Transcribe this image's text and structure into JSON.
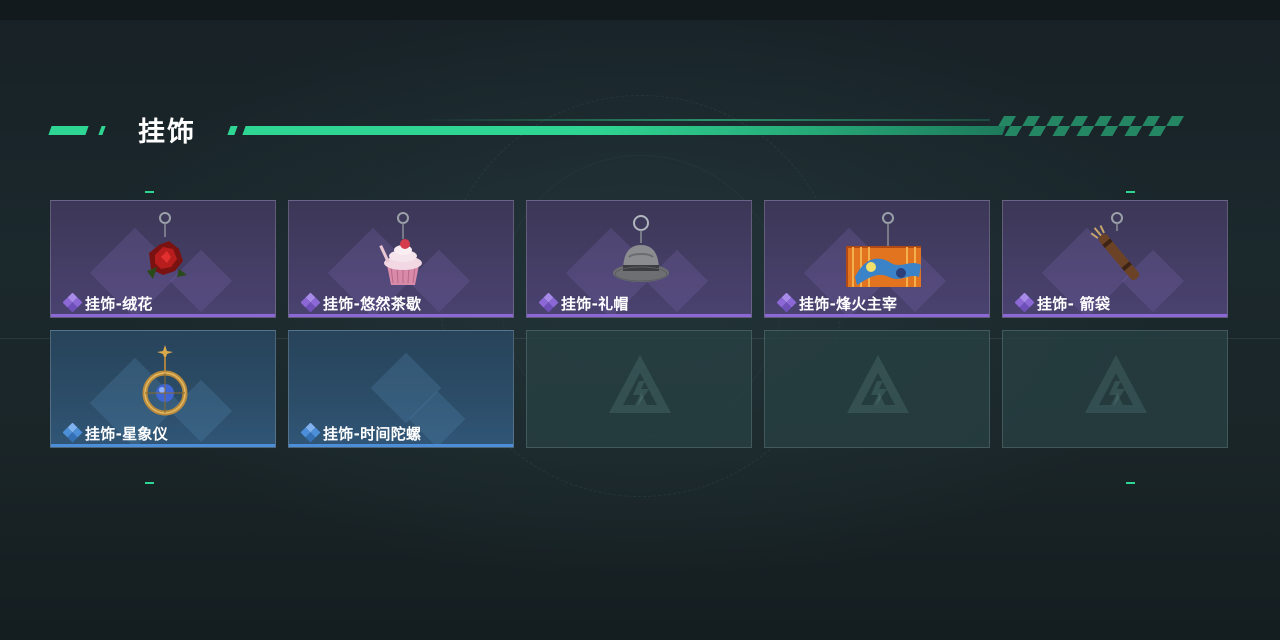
{
  "section": {
    "title": "挂饰"
  },
  "items": [
    {
      "name": "挂饰-绒花",
      "rarity": "purple",
      "icon": "rose-charm-icon"
    },
    {
      "name": "挂饰-悠然茶歇",
      "rarity": "purple",
      "icon": "cupcake-charm-icon"
    },
    {
      "name": "挂饰-礼帽",
      "rarity": "purple",
      "icon": "fedora-hat-charm-icon"
    },
    {
      "name": "挂饰-烽火主宰",
      "rarity": "purple",
      "icon": "banner-charm-icon"
    },
    {
      "name": "挂饰- 箭袋",
      "rarity": "purple",
      "icon": "quiver-charm-icon"
    },
    {
      "name": "挂饰-星象仪",
      "rarity": "blue",
      "icon": "astrolabe-charm-icon"
    },
    {
      "name": "挂饰-时间陀螺",
      "rarity": "blue",
      "icon": "",
      "has_image": false
    }
  ],
  "empty_slots": 3,
  "colors": {
    "accent": "#2fd693",
    "purple_rarity": "#8b68d6",
    "blue_rarity": "#4c8ed8"
  }
}
